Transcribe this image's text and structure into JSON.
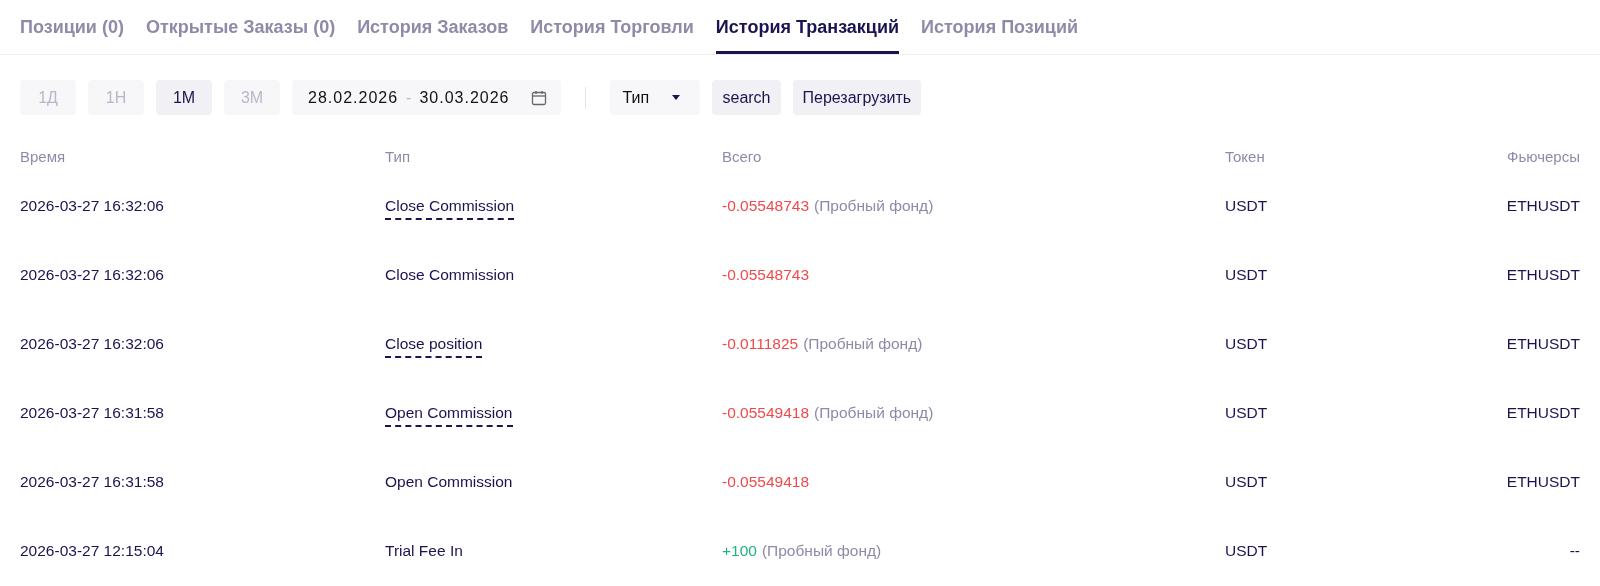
{
  "tabs": [
    {
      "label": "Позиции (0)",
      "selected": false
    },
    {
      "label": "Открытые Заказы (0)",
      "selected": false
    },
    {
      "label": "История Заказов",
      "selected": false
    },
    {
      "label": "История Торговли",
      "selected": false
    },
    {
      "label": "История Транзакций",
      "selected": true
    },
    {
      "label": "История Позиций",
      "selected": false
    }
  ],
  "filters": {
    "periods": [
      {
        "label": "1Д",
        "selected": false
      },
      {
        "label": "1Н",
        "selected": false
      },
      {
        "label": "1М",
        "selected": true
      },
      {
        "label": "3М",
        "selected": false
      }
    ],
    "date_range": {
      "start": "28.02.2026",
      "separator": "-",
      "end": "30.03.2026"
    },
    "type_select": {
      "value": "Тип"
    },
    "buttons": [
      "search",
      "Перезагрузить"
    ]
  },
  "table": {
    "columns": [
      "Время",
      "Тип",
      "Всего",
      "Токен",
      "Фьючерсы"
    ],
    "rows": [
      {
        "time": "2026-03-27 16:32:06",
        "type": "Close Commission",
        "has_tooltip": true,
        "amount": "-0.05548743",
        "color": "#f0494b",
        "note": "(Пробный фонд)",
        "token": "USDT",
        "futures": "ETHUSDT"
      },
      {
        "time": "2026-03-27 16:32:06",
        "type": "Close Commission",
        "has_tooltip": false,
        "amount": "-0.05548743",
        "color": "#f0494b",
        "token": "USDT",
        "futures": "ETHUSDT"
      },
      {
        "time": "2026-03-27 16:32:06",
        "type": "Close position",
        "has_tooltip": true,
        "amount": "-0.0111825",
        "color": "#f0494b",
        "note": "(Пробный фонд)",
        "token": "USDT",
        "futures": "ETHUSDT"
      },
      {
        "time": "2026-03-27 16:31:58",
        "type": "Open Commission",
        "has_tooltip": true,
        "amount": "-0.05549418",
        "color": "#f0494b",
        "note": "(Пробный фонд)",
        "token": "USDT",
        "futures": "ETHUSDT"
      },
      {
        "time": "2026-03-27 16:31:58",
        "type": "Open Commission",
        "has_tooltip": false,
        "amount": "-0.05549418",
        "color": "#f0494b",
        "token": "USDT",
        "futures": "ETHUSDT"
      },
      {
        "time": "2026-03-27 12:15:04",
        "type": "Trial Fee In",
        "has_tooltip": false,
        "amount": "+100",
        "color": "#1fb27c",
        "note": "(Пробный фонд)",
        "token": "USDT",
        "futures": "--"
      }
    ]
  }
}
